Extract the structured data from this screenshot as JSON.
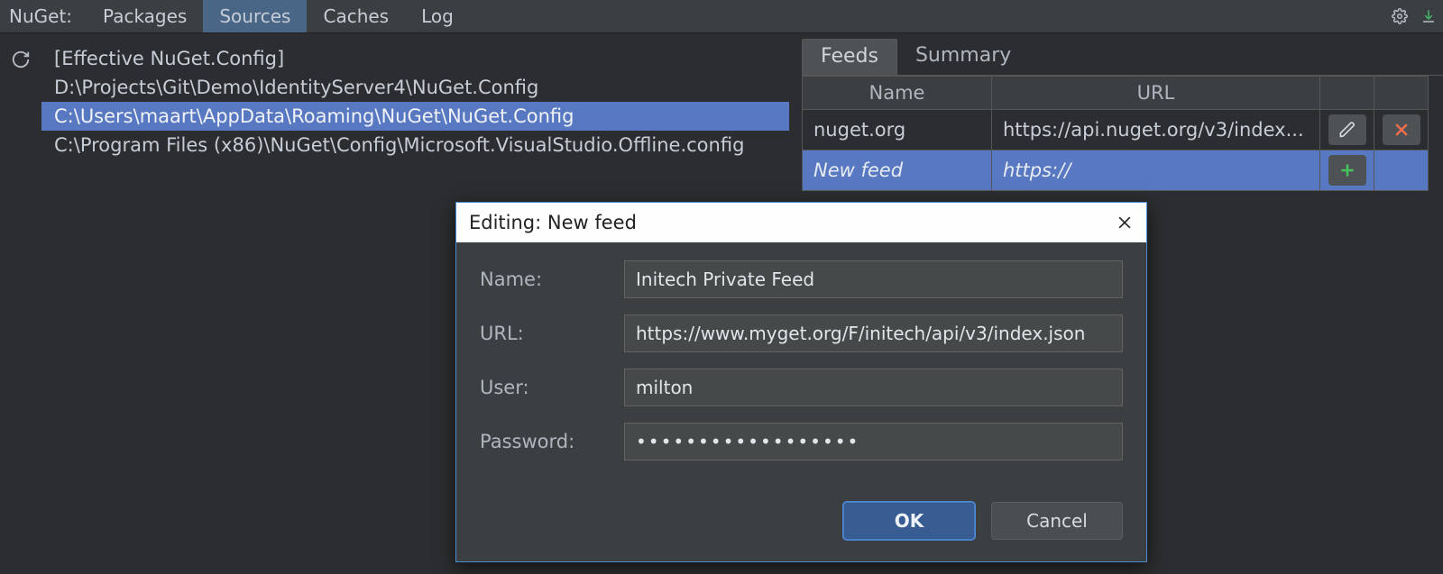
{
  "topbar": {
    "title": "NuGet:",
    "tabs": [
      {
        "label": "Packages",
        "active": false
      },
      {
        "label": "Sources",
        "active": true
      },
      {
        "label": "Caches",
        "active": false
      },
      {
        "label": "Log",
        "active": false
      }
    ]
  },
  "configs": [
    {
      "label": "[Effective NuGet.Config]",
      "selected": false
    },
    {
      "label": "D:\\Projects\\Git\\Demo\\IdentityServer4\\NuGet.Config",
      "selected": false
    },
    {
      "label": "C:\\Users\\maart\\AppData\\Roaming\\NuGet\\NuGet.Config",
      "selected": true
    },
    {
      "label": "C:\\Program Files (x86)\\NuGet\\Config\\Microsoft.VisualStudio.Offline.config",
      "selected": false
    }
  ],
  "feeds": {
    "tab_feeds": "Feeds",
    "tab_summary": "Summary",
    "col_name": "Name",
    "col_url": "URL",
    "rows": [
      {
        "name": "nuget.org",
        "url": "https://api.nuget.org/v3/index...",
        "mode": "existing"
      },
      {
        "name": "New feed",
        "url": "https://",
        "mode": "new"
      }
    ]
  },
  "dialog": {
    "title": "Editing: New feed",
    "labels": {
      "name": "Name:",
      "url": "URL:",
      "user": "User:",
      "password": "Password:"
    },
    "values": {
      "name": "Initech Private Feed",
      "url": "https://www.myget.org/F/initech/api/v3/index.json",
      "user": "milton",
      "password": "••••••••••••••••••"
    },
    "ok": "OK",
    "cancel": "Cancel"
  }
}
